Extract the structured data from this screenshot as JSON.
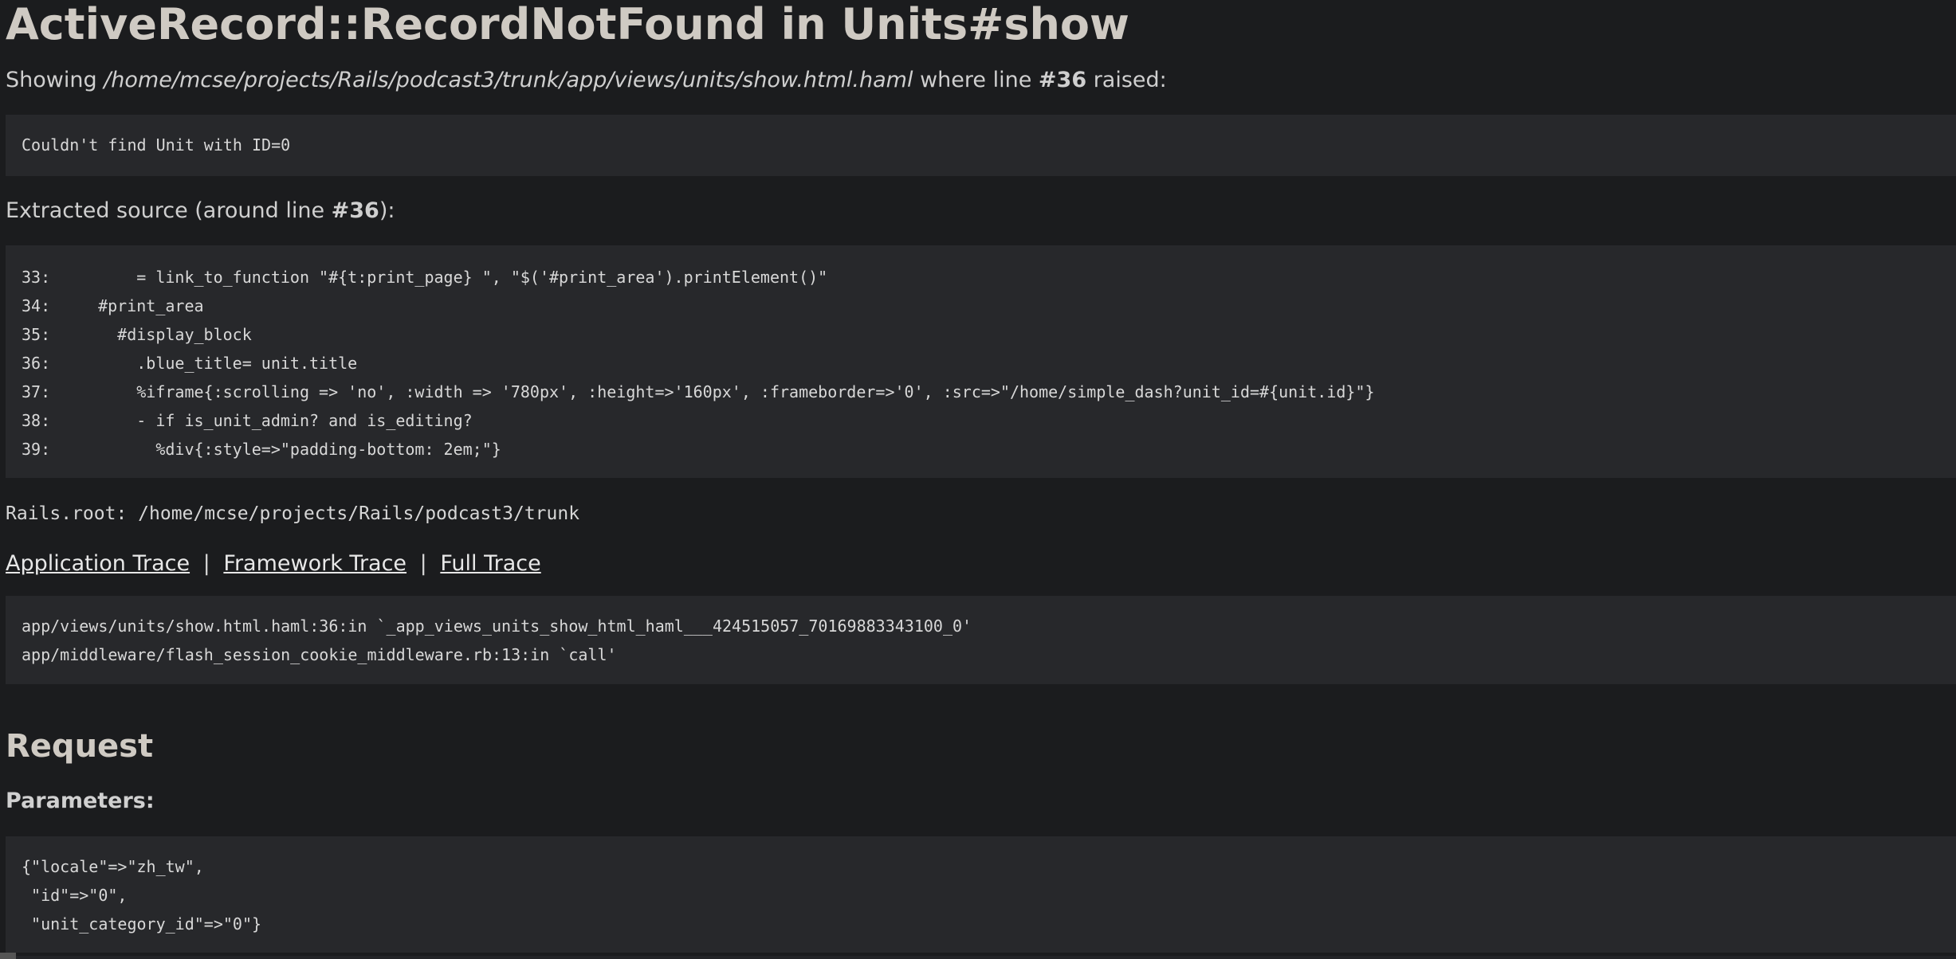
{
  "error": {
    "title": "ActiveRecord::RecordNotFound in Units#show",
    "showing_prefix": "Showing",
    "template_path": "/home/mcse/projects/Rails/podcast3/trunk/app/views/units/show.html.haml",
    "where_line": "where line",
    "line_ref": "#36",
    "raised": "raised:",
    "message": "Couldn't find Unit with ID=0"
  },
  "extracted": {
    "prefix": "Extracted source (around line ",
    "line_ref": "#36",
    "suffix": "):",
    "lines": [
      {
        "num": "33:",
        "code": "      = link_to_function \"#{t:print_page} \", \"$('#print_area').printElement()\""
      },
      {
        "num": "34:",
        "code": "  #print_area"
      },
      {
        "num": "35:",
        "code": "    #display_block"
      },
      {
        "num": "36:",
        "code": "      .blue_title= unit.title"
      },
      {
        "num": "37:",
        "code": "      %iframe{:scrolling => 'no', :width => '780px', :height=>'160px', :frameborder=>'0', :src=>\"/home/simple_dash?unit_id=#{unit.id}\"}"
      },
      {
        "num": "38:",
        "code": "      - if is_unit_admin? and is_editing?"
      },
      {
        "num": "39:",
        "code": "        %div{:style=>\"padding-bottom: 2em;\"}"
      }
    ]
  },
  "rails_root": "Rails.root: /home/mcse/projects/Rails/podcast3/trunk",
  "trace_links": {
    "application": "Application Trace",
    "framework": "Framework Trace",
    "full": "Full Trace",
    "separator": "|"
  },
  "trace_lines": [
    "app/views/units/show.html.haml:36:in `_app_views_units_show_html_haml___424515057_70169883343100_0'",
    "app/middleware/flash_session_cookie_middleware.rb:13:in `call'"
  ],
  "request": {
    "heading": "Request",
    "params_label": "Parameters:",
    "params_lines": [
      "{\"locale\"=>\"zh_tw\",",
      " \"id\"=>\"0\",",
      " \"unit_category_id\"=>\"0\"}"
    ]
  }
}
